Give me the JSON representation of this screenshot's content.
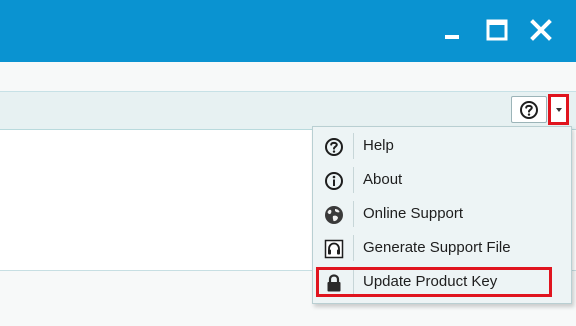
{
  "window": {
    "accent_color": "#0a93d1",
    "highlight_color": "#e0141e",
    "controls": [
      {
        "name": "minimize",
        "icon": "minimize-icon"
      },
      {
        "name": "maximize",
        "icon": "maximize-icon"
      },
      {
        "name": "close",
        "icon": "close-icon"
      }
    ]
  },
  "toolbar": {
    "help_icon": "question-circle-icon",
    "dropdown_icon": "caret-down-icon"
  },
  "menu": {
    "items": [
      {
        "label": "Help",
        "icon": "question-circle-icon"
      },
      {
        "label": "About",
        "icon": "info-circle-icon"
      },
      {
        "label": "Online Support",
        "icon": "globe-icon"
      },
      {
        "label": "Generate Support File",
        "icon": "headset-icon"
      },
      {
        "label": "Update Product Key",
        "icon": "lock-icon",
        "highlighted": true
      }
    ]
  }
}
